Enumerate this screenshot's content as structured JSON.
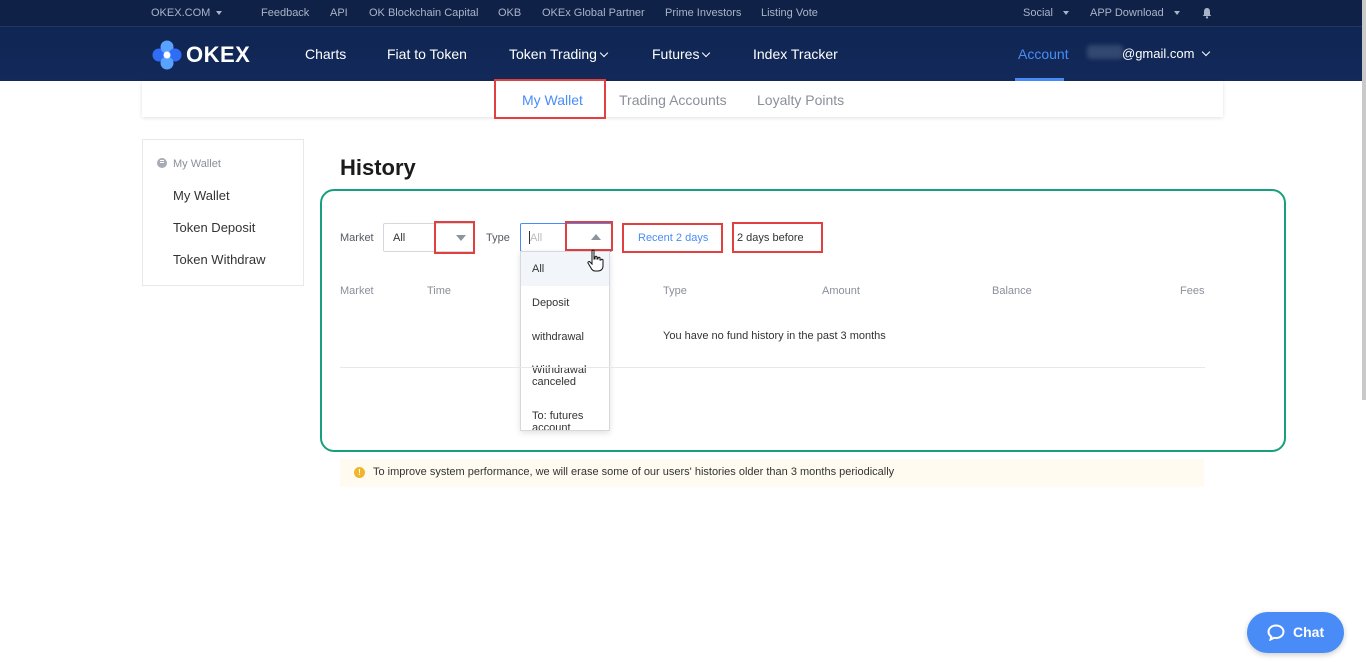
{
  "topbar": {
    "okex_com": "OKEX.COM",
    "links": [
      "Feedback",
      "API",
      "OK Blockchain Capital",
      "OKB",
      "OKEx Global Partner",
      "Prime Investors",
      "Listing Vote"
    ],
    "social": "Social",
    "app_download": "APP Download",
    "bell_icon": "bell-icon"
  },
  "navbar": {
    "logo_text": "OKEX",
    "items": [
      "Charts",
      "Fiat to Token",
      "Token Trading",
      "Futures",
      "Index Tracker"
    ],
    "account": "Account",
    "email": "@gmail.com"
  },
  "subnav": {
    "tabs": [
      "My Wallet",
      "Trading Accounts",
      "Loyalty Points"
    ],
    "active": "My Wallet"
  },
  "sidebar": {
    "header": "My Wallet",
    "items": [
      "My Wallet",
      "Token Deposit",
      "Token Withdraw"
    ]
  },
  "history": {
    "title": "History",
    "market_label": "Market",
    "market_value": "All",
    "type_label": "Type",
    "type_placeholder": "All",
    "type_options": [
      "All",
      "Deposit",
      "withdrawal",
      "Withdrawal canceled",
      "To: futures account"
    ],
    "quick_recent": "Recent 2 days",
    "quick_before": "2 days before",
    "columns": [
      "Market",
      "Time",
      "Type",
      "Amount",
      "Balance",
      "Fees"
    ],
    "empty_message": "You have no fund history in the past 3 months"
  },
  "notice": {
    "text": "To improve system performance, we will erase some of our users' histories older than 3 months periodically"
  },
  "chat": {
    "label": "Chat"
  },
  "colors": {
    "brand_navy": "#0f2653",
    "accent_blue": "#4a8cf7",
    "highlight_red": "#e0403f",
    "teal_outline": "#18a07e"
  }
}
